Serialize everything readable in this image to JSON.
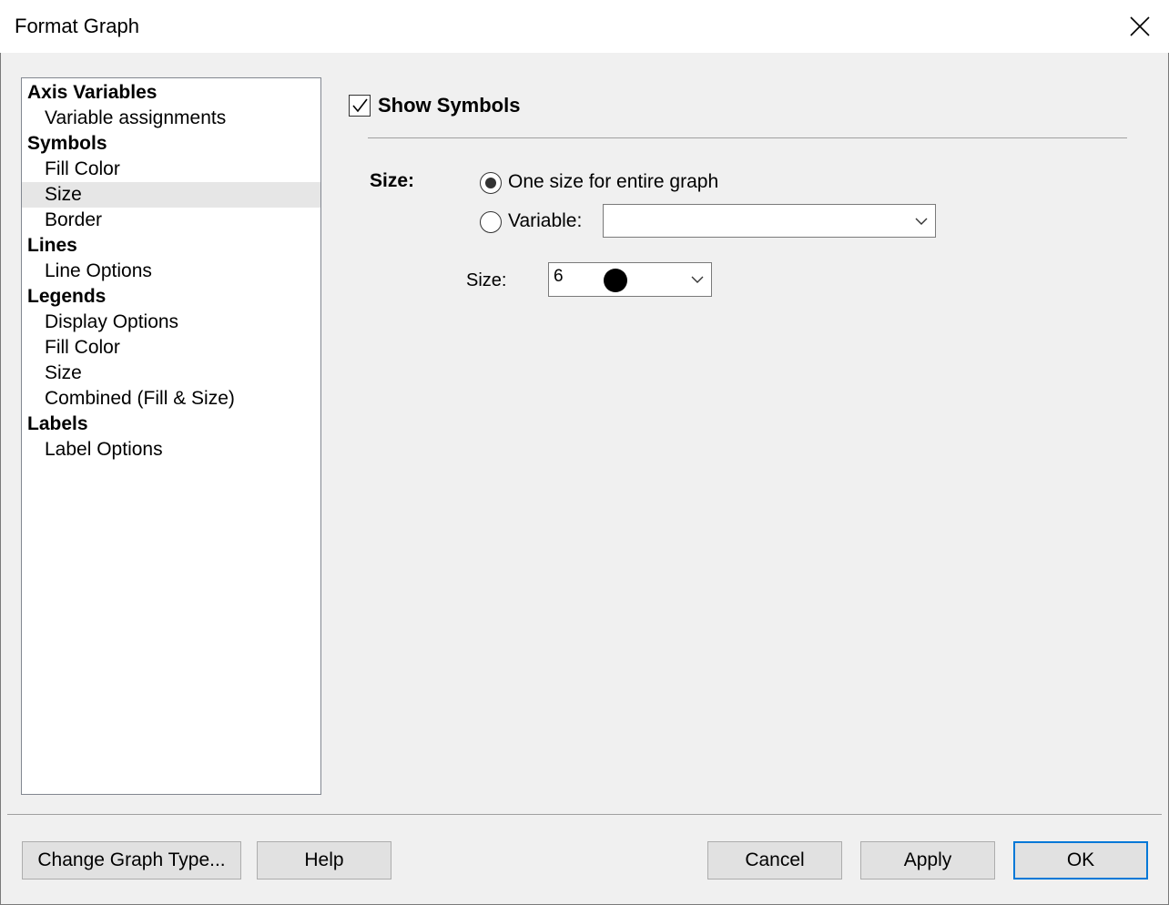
{
  "window": {
    "title": "Format Graph",
    "close_icon": "close-icon"
  },
  "tree": {
    "items": [
      {
        "label": "Axis Variables",
        "level": "category"
      },
      {
        "label": "Variable assignments",
        "level": "sub"
      },
      {
        "label": "Symbols",
        "level": "category"
      },
      {
        "label": "Fill Color",
        "level": "sub"
      },
      {
        "label": "Size",
        "level": "sub",
        "selected": true
      },
      {
        "label": "Border",
        "level": "sub"
      },
      {
        "label": "Lines",
        "level": "category"
      },
      {
        "label": "Line Options",
        "level": "sub"
      },
      {
        "label": "Legends",
        "level": "category"
      },
      {
        "label": "Display Options",
        "level": "sub"
      },
      {
        "label": "Fill Color",
        "level": "sub"
      },
      {
        "label": "Size",
        "level": "sub"
      },
      {
        "label": "Combined (Fill & Size)",
        "level": "sub"
      },
      {
        "label": "Labels",
        "level": "category"
      },
      {
        "label": "Label Options",
        "level": "sub"
      }
    ]
  },
  "panel": {
    "show_symbols_label": "Show Symbols",
    "show_symbols_checked": true,
    "size_heading": "Size:",
    "radio_one_size_label": "One size for entire graph",
    "radio_one_size_selected": true,
    "radio_variable_label": "Variable:",
    "radio_variable_selected": false,
    "variable_combo_value": "",
    "size_label": "Size:",
    "size_value": "6"
  },
  "buttons": {
    "change_graph_type": "Change Graph Type...",
    "help": "Help",
    "cancel": "Cancel",
    "apply": "Apply",
    "ok": "OK"
  }
}
